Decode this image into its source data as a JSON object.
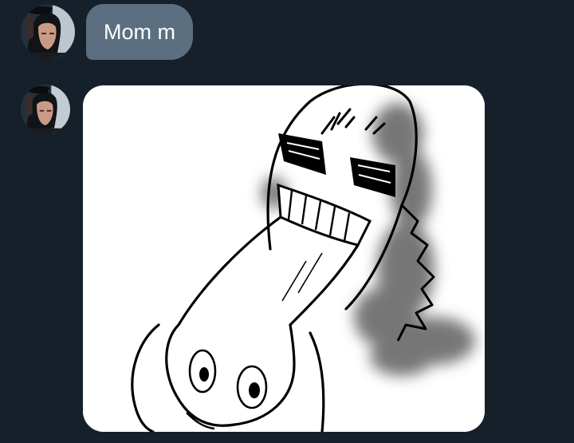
{
  "conversation": {
    "messages": [
      {
        "type": "text",
        "text": "Mom m",
        "avatar_icon": "profile-photo-icon"
      },
      {
        "type": "image",
        "avatar_icon": "profile-photo-icon",
        "image_icon": "screaming-sketch-drawing-icon"
      }
    ]
  },
  "colors": {
    "background": "#15202b",
    "bubble": "#5b6f80",
    "bubble_text": "#ffffff",
    "image_card": "#ffffff"
  }
}
